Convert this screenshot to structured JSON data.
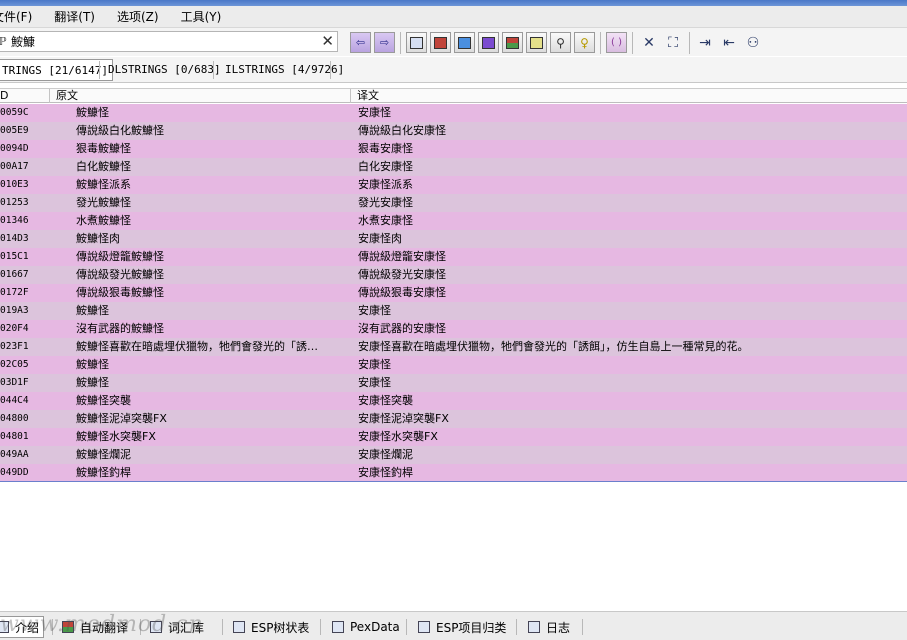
{
  "menu": [
    "文件(F)",
    "翻译(T)",
    "选项(Z)",
    "工具(Y)"
  ],
  "search": {
    "value": "鮟鱇"
  },
  "string_tabs": [
    "TRINGS [21/6147]",
    "DLSTRINGS [0/683]",
    "ILSTRINGS [4/9726]"
  ],
  "columns": {
    "id": "D",
    "source": "原文",
    "translation": "译文"
  },
  "rows": [
    {
      "id": "0059C",
      "src": "鮟鱇怪",
      "tr": "安康怪"
    },
    {
      "id": "005E9",
      "src": "傳說級白化鮟鱇怪",
      "tr": "傳說級白化安康怪"
    },
    {
      "id": "0094D",
      "src": "狠毒鮟鱇怪",
      "tr": "狠毒安康怪"
    },
    {
      "id": "00A17",
      "src": "白化鮟鱇怪",
      "tr": "白化安康怪"
    },
    {
      "id": "010E3",
      "src": "鮟鱇怪派系",
      "tr": "安康怪派系"
    },
    {
      "id": "01253",
      "src": "發光鮟鱇怪",
      "tr": "發光安康怪"
    },
    {
      "id": "01346",
      "src": "水煮鮟鱇怪",
      "tr": "水煮安康怪"
    },
    {
      "id": "014D3",
      "src": "鮟鱇怪肉",
      "tr": "安康怪肉"
    },
    {
      "id": "015C1",
      "src": "傳說級燈籠鮟鱇怪",
      "tr": "傳說級燈籠安康怪"
    },
    {
      "id": "01667",
      "src": "傳說級發光鮟鱇怪",
      "tr": "傳說級發光安康怪"
    },
    {
      "id": "0172F",
      "src": "傳說級狠毒鮟鱇怪",
      "tr": "傳說級狠毒安康怪"
    },
    {
      "id": "019A3",
      "src": "鮟鱇怪",
      "tr": "安康怪"
    },
    {
      "id": "020F4",
      "src": "沒有武器的鮟鱇怪",
      "tr": "沒有武器的安康怪"
    },
    {
      "id": "023F1",
      "src": "鮟鱇怪喜歡在暗處埋伏獵物，牠們會發光的「誘…",
      "tr": "安康怪喜歡在暗處埋伏獵物，牠們會發光的「誘餌」，仿生自島上一種常見的花。"
    },
    {
      "id": "02C05",
      "src": "鮟鱇怪",
      "tr": "安康怪"
    },
    {
      "id": "03D1F",
      "src": "鮟鱇怪",
      "tr": "安康怪"
    },
    {
      "id": "044C4",
      "src": "鮟鱇怪突襲",
      "tr": "安康怪突襲"
    },
    {
      "id": "04800",
      "src": "鮟鱇怪泥淖突襲FX",
      "tr": "安康怪泥淖突襲FX"
    },
    {
      "id": "04801",
      "src": "鮟鱇怪水突襲FX",
      "tr": "安康怪水突襲FX"
    },
    {
      "id": "049AA",
      "src": "鮟鱇怪爛泥",
      "tr": "安康怪爛泥"
    },
    {
      "id": "049DD",
      "src": "鮟鱇怪釣桿",
      "tr": "安康怪釣桿"
    }
  ],
  "bottom_tabs": [
    "介绍",
    "自动翻译",
    "词汇库",
    "ESP树状表",
    "PexData",
    "ESP项目归类",
    "日志"
  ],
  "watermark": "www.modmod.cn",
  "colors": {
    "row_odd": "#e6b8e2",
    "row_even": "#dcc4dc",
    "accent": "#4a78c8"
  }
}
